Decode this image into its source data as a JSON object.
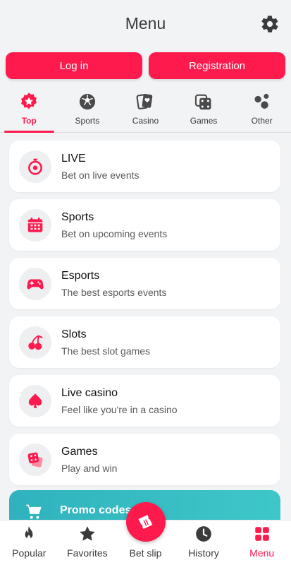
{
  "header": {
    "title": "Menu",
    "settings_icon": "gear-icon"
  },
  "auth": {
    "login_label": "Log in",
    "register_label": "Registration"
  },
  "tabs": [
    {
      "label": "Top",
      "icon": "star-badge-icon",
      "active": true
    },
    {
      "label": "Sports",
      "icon": "soccer-ball-icon",
      "active": false
    },
    {
      "label": "Casino",
      "icon": "playing-cards-icon",
      "active": false
    },
    {
      "label": "Games",
      "icon": "dice-icon",
      "active": false
    },
    {
      "label": "Other",
      "icon": "bubbles-icon",
      "active": false
    }
  ],
  "menu_items": [
    {
      "title": "LIVE",
      "subtitle": "Bet on live events",
      "icon": "stopwatch-icon"
    },
    {
      "title": "Sports",
      "subtitle": "Bet on upcoming events",
      "icon": "calendar-icon"
    },
    {
      "title": "Esports",
      "subtitle": "The best esports events",
      "icon": "gamepad-icon"
    },
    {
      "title": "Slots",
      "subtitle": "The best slot games",
      "icon": "cherries-icon"
    },
    {
      "title": "Live casino",
      "subtitle": "Feel like you're in a casino",
      "icon": "spade-icon"
    },
    {
      "title": "Games",
      "subtitle": "Play and win",
      "icon": "dice-icon"
    }
  ],
  "promo": {
    "title": "Promo codes",
    "icon": "cart-icon"
  },
  "bottom_nav": [
    {
      "label": "Popular",
      "icon": "flame-icon",
      "active": false
    },
    {
      "label": "Favorites",
      "icon": "star-icon",
      "active": false
    },
    {
      "label": "Bet slip",
      "icon": "ticket-icon",
      "active": false
    },
    {
      "label": "History",
      "icon": "clock-icon",
      "active": false
    },
    {
      "label": "Menu",
      "icon": "grid-icon",
      "active": true
    }
  ],
  "colors": {
    "accent": "#ff1a4d",
    "promo": "#2fb2bd",
    "background": "#f2f3f5"
  }
}
